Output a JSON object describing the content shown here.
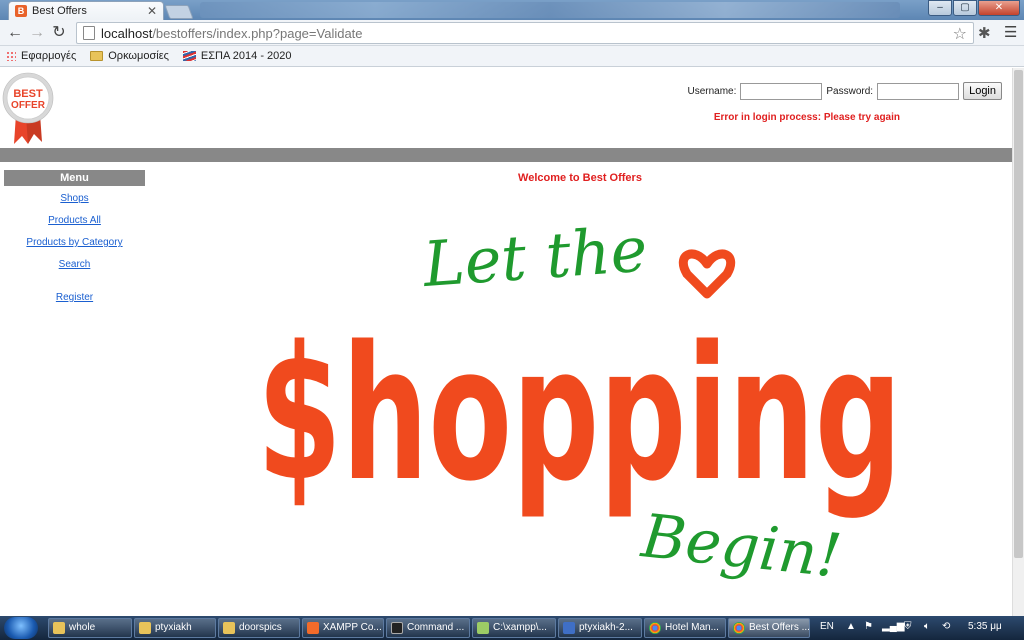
{
  "browser": {
    "tab_title": "Best Offers",
    "tab_close": "✕",
    "url_host": "localhost",
    "url_path": "/bestoffers/index.php?page=Validate",
    "bookmarks": [
      "Εφαρμογές",
      "Ορκωμοσίες",
      "ΕΣΠΑ 2014 - 2020"
    ],
    "window_buttons": [
      "‒",
      "▢",
      "✕"
    ]
  },
  "header": {
    "username_label": "Username:",
    "password_label": "Password:",
    "login_button": "Login",
    "error": "Error in login process: Please try again",
    "logo_text_1": "BEST",
    "logo_text_2": "OFFER"
  },
  "menu": {
    "title": "Menu",
    "items": [
      "Shops",
      "Products All",
      "Products by Category",
      "Search"
    ],
    "register": "Register"
  },
  "main": {
    "welcome": "Welcome to Best Offers",
    "banner_top": "Let the",
    "banner_main": "$hopping",
    "banner_bottom": "Begin!"
  },
  "taskbar": {
    "items": [
      "whole",
      "ptyxiakh",
      "doorspics",
      "XAMPP Co...",
      "Command ...",
      "C:\\xampp\\...",
      "ptyxiakh-2...",
      "Hotel Man...",
      "Best Offers ..."
    ],
    "lang": "EN",
    "time": "5:35 μμ"
  },
  "colors": {
    "accent_red": "#e02020",
    "banner_orange": "#f04a1e",
    "banner_green": "#1f9a2e",
    "link_blue": "#1a5fd0"
  }
}
